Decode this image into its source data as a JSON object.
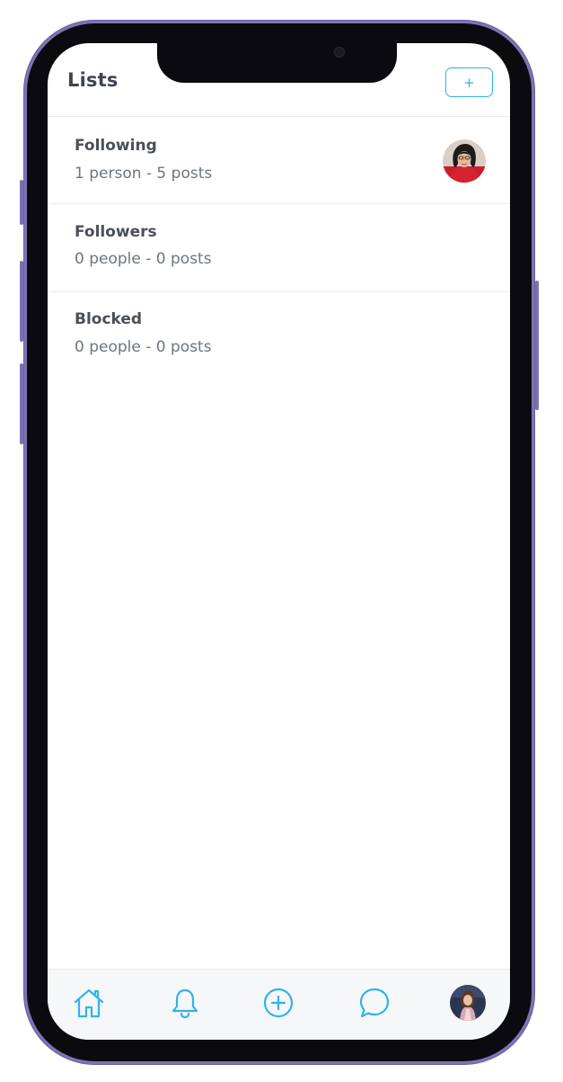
{
  "colors": {
    "accent": "#31b3e8",
    "frame": "#8073b5",
    "title_text": "#3f4450",
    "subtitle_text": "#6e7482",
    "divider": "#ececf0",
    "tabbar_bg": "#f6f7f9"
  },
  "header": {
    "title": "Lists",
    "add_label": "+"
  },
  "lists": [
    {
      "name": "Following",
      "summary": "1 person - 5 posts",
      "has_avatar": true
    },
    {
      "name": "Followers",
      "summary": "0 people - 0 posts",
      "has_avatar": false
    },
    {
      "name": "Blocked",
      "summary": "0 people - 0 posts",
      "has_avatar": false
    }
  ],
  "tabbar": {
    "items": [
      {
        "id": "home",
        "icon": "home-icon"
      },
      {
        "id": "notifications",
        "icon": "bell-icon"
      },
      {
        "id": "create",
        "icon": "plus-circle-icon"
      },
      {
        "id": "messages",
        "icon": "chat-bubble-icon"
      },
      {
        "id": "profile",
        "icon": "profile-avatar"
      }
    ]
  }
}
